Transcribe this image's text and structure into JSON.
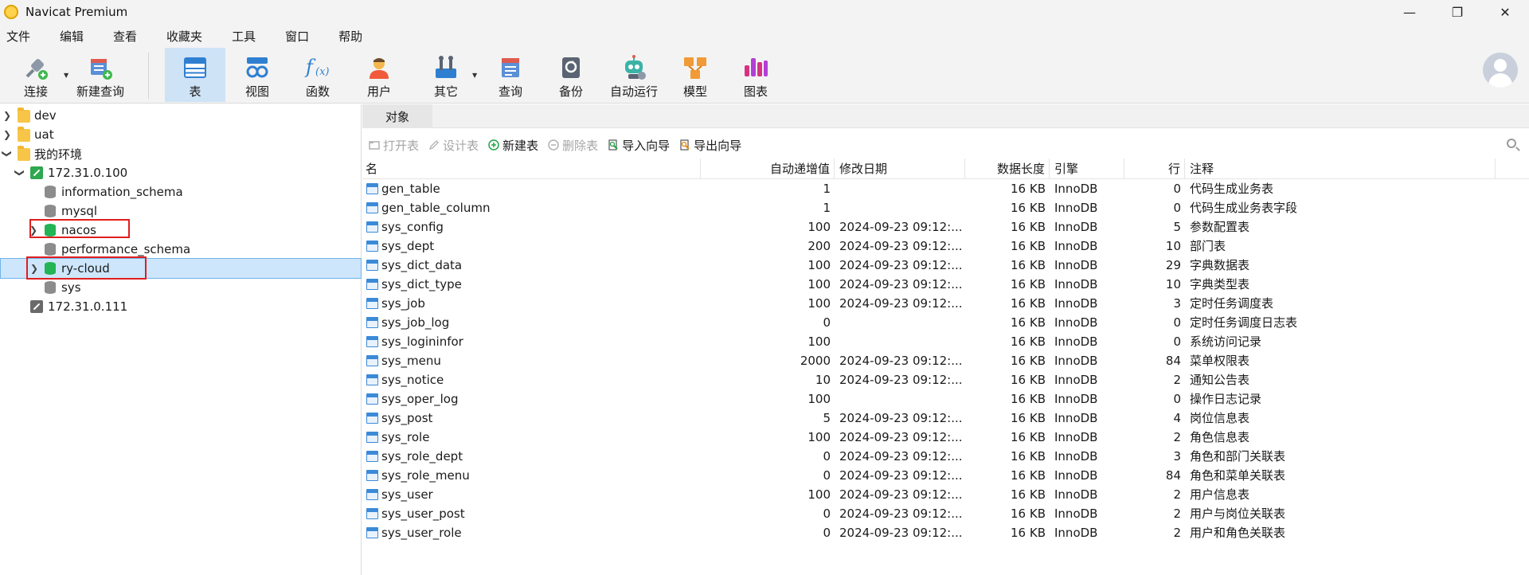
{
  "window": {
    "title": "Navicat Premium"
  },
  "menu": [
    "文件",
    "编辑",
    "查看",
    "收藏夹",
    "工具",
    "窗口",
    "帮助"
  ],
  "toolbar": {
    "buttons": [
      {
        "label": "连接",
        "icon": "connection-plug-icon"
      },
      {
        "label": "新建查询",
        "icon": "new-query-icon"
      },
      {
        "label": "表",
        "icon": "table-icon",
        "active": true
      },
      {
        "label": "视图",
        "icon": "view-glasses-icon"
      },
      {
        "label": "函数",
        "icon": "function-fx-icon"
      },
      {
        "label": "用户",
        "icon": "user-icon"
      },
      {
        "label": "其它",
        "icon": "tools-icon"
      },
      {
        "label": "查询",
        "icon": "query-icon"
      },
      {
        "label": "备份",
        "icon": "backup-icon"
      },
      {
        "label": "自动运行",
        "icon": "robot-icon"
      },
      {
        "label": "模型",
        "icon": "model-icon"
      },
      {
        "label": "图表",
        "icon": "chart-icon"
      }
    ]
  },
  "tree": {
    "items": [
      {
        "label": "dev",
        "type": "folder",
        "level": 0,
        "expander": "collapsed"
      },
      {
        "label": "uat",
        "type": "folder",
        "level": 0,
        "expander": "collapsed"
      },
      {
        "label": "我的环境",
        "type": "folder",
        "level": 0,
        "expander": "expanded"
      },
      {
        "label": "172.31.0.100",
        "type": "connection-open",
        "level": 1,
        "expander": "expanded"
      },
      {
        "label": "information_schema",
        "type": "db-closed",
        "level": 2,
        "expander": "none"
      },
      {
        "label": "mysql",
        "type": "db-closed",
        "level": 2,
        "expander": "none"
      },
      {
        "label": "nacos",
        "type": "db-open",
        "level": 2,
        "expander": "collapsed",
        "highlighted": true
      },
      {
        "label": "performance_schema",
        "type": "db-closed",
        "level": 2,
        "expander": "none"
      },
      {
        "label": "ry-cloud",
        "type": "db-open",
        "level": 2,
        "expander": "collapsed",
        "highlighted": true,
        "selected": true
      },
      {
        "label": "sys",
        "type": "db-closed",
        "level": 2,
        "expander": "none"
      },
      {
        "label": "172.31.0.111",
        "type": "connection-closed",
        "level": 1,
        "expander": "none"
      }
    ]
  },
  "tabs": [
    {
      "label": "对象"
    }
  ],
  "object_toolbar": [
    {
      "label": "打开表",
      "enabled": false,
      "icon": "open-table-icon"
    },
    {
      "label": "设计表",
      "enabled": false,
      "icon": "design-table-icon"
    },
    {
      "label": "新建表",
      "enabled": true,
      "icon": "new-table-icon"
    },
    {
      "label": "删除表",
      "enabled": false,
      "icon": "delete-table-icon"
    },
    {
      "label": "导入向导",
      "enabled": true,
      "icon": "import-wizard-icon"
    },
    {
      "label": "导出向导",
      "enabled": true,
      "icon": "export-wizard-icon"
    }
  ],
  "table": {
    "columns": [
      "名",
      "自动递增值",
      "修改日期",
      "数据长度",
      "引擎",
      "行",
      "注释"
    ],
    "rows": [
      [
        "gen_table",
        "1",
        "",
        "16 KB",
        "InnoDB",
        "0",
        "代码生成业务表"
      ],
      [
        "gen_table_column",
        "1",
        "",
        "16 KB",
        "InnoDB",
        "0",
        "代码生成业务表字段"
      ],
      [
        "sys_config",
        "100",
        "2024-09-23 09:12:...",
        "16 KB",
        "InnoDB",
        "5",
        "参数配置表"
      ],
      [
        "sys_dept",
        "200",
        "2024-09-23 09:12:...",
        "16 KB",
        "InnoDB",
        "10",
        "部门表"
      ],
      [
        "sys_dict_data",
        "100",
        "2024-09-23 09:12:...",
        "16 KB",
        "InnoDB",
        "29",
        "字典数据表"
      ],
      [
        "sys_dict_type",
        "100",
        "2024-09-23 09:12:...",
        "16 KB",
        "InnoDB",
        "10",
        "字典类型表"
      ],
      [
        "sys_job",
        "100",
        "2024-09-23 09:12:...",
        "16 KB",
        "InnoDB",
        "3",
        "定时任务调度表"
      ],
      [
        "sys_job_log",
        "0",
        "",
        "16 KB",
        "InnoDB",
        "0",
        "定时任务调度日志表"
      ],
      [
        "sys_logininfor",
        "100",
        "",
        "16 KB",
        "InnoDB",
        "0",
        "系统访问记录"
      ],
      [
        "sys_menu",
        "2000",
        "2024-09-23 09:12:...",
        "16 KB",
        "InnoDB",
        "84",
        "菜单权限表"
      ],
      [
        "sys_notice",
        "10",
        "2024-09-23 09:12:...",
        "16 KB",
        "InnoDB",
        "2",
        "通知公告表"
      ],
      [
        "sys_oper_log",
        "100",
        "",
        "16 KB",
        "InnoDB",
        "0",
        "操作日志记录"
      ],
      [
        "sys_post",
        "5",
        "2024-09-23 09:12:...",
        "16 KB",
        "InnoDB",
        "4",
        "岗位信息表"
      ],
      [
        "sys_role",
        "100",
        "2024-09-23 09:12:...",
        "16 KB",
        "InnoDB",
        "2",
        "角色信息表"
      ],
      [
        "sys_role_dept",
        "0",
        "2024-09-23 09:12:...",
        "16 KB",
        "InnoDB",
        "3",
        "角色和部门关联表"
      ],
      [
        "sys_role_menu",
        "0",
        "2024-09-23 09:12:...",
        "16 KB",
        "InnoDB",
        "84",
        "角色和菜单关联表"
      ],
      [
        "sys_user",
        "100",
        "2024-09-23 09:12:...",
        "16 KB",
        "InnoDB",
        "2",
        "用户信息表"
      ],
      [
        "sys_user_post",
        "0",
        "2024-09-23 09:12:...",
        "16 KB",
        "InnoDB",
        "2",
        "用户与岗位关联表"
      ],
      [
        "sys_user_role",
        "0",
        "2024-09-23 09:12:...",
        "16 KB",
        "InnoDB",
        "2",
        "用户和角色关联表"
      ]
    ]
  }
}
